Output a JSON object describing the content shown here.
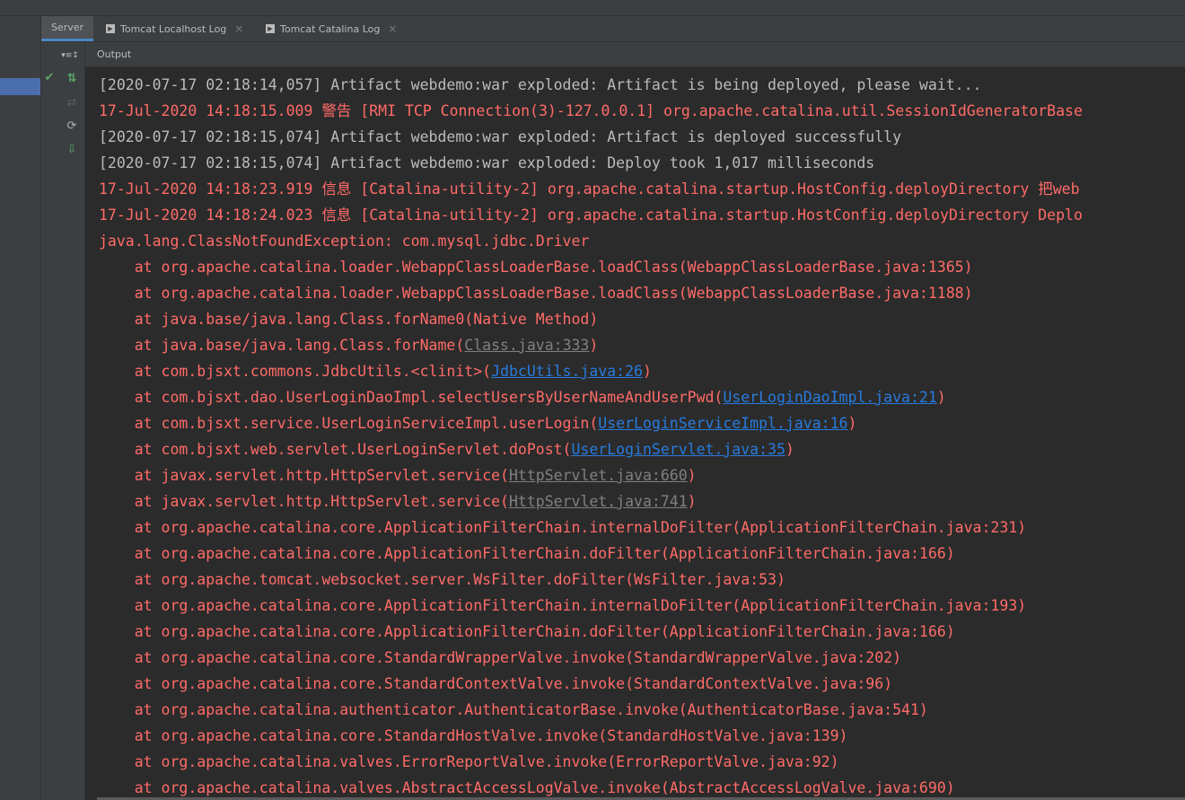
{
  "tabs": [
    {
      "label": "Server",
      "active": true,
      "closable": false
    },
    {
      "label": "Tomcat Localhost Log",
      "active": false,
      "closable": true
    },
    {
      "label": "Tomcat Catalina Log",
      "active": false,
      "closable": true
    }
  ],
  "tab_close_glyph": "×",
  "tab_run_glyph": "▶",
  "header": {
    "output_label": "Output"
  },
  "toolbar": {
    "options_glyph": "▾≡↕",
    "status_glyph": "✔",
    "update_glyph": "⇅",
    "redeploy_glyph": "⇄",
    "refresh_glyph": "⟳",
    "deploy_glyph": "⇩"
  },
  "colors": {
    "info": "#bbbbbb",
    "error": "#ff6b68",
    "link": "#287bde",
    "link_muted": "#808080",
    "accent": "#4b6eaf"
  },
  "log": {
    "lines": [
      {
        "type": "info",
        "text": "[2020-07-17 02:18:14,057] Artifact webdemo:war exploded: Artifact is being deployed, please wait..."
      },
      {
        "type": "err",
        "text": "17-Jul-2020 14:18:15.009 警告 [RMI TCP Connection(3)-127.0.0.1] org.apache.catalina.util.SessionIdGeneratorBase"
      },
      {
        "type": "info",
        "text": "[2020-07-17 02:18:15,074] Artifact webdemo:war exploded: Artifact is deployed successfully"
      },
      {
        "type": "info",
        "text": "[2020-07-17 02:18:15,074] Artifact webdemo:war exploded: Deploy took 1,017 milliseconds"
      },
      {
        "type": "err",
        "text": "17-Jul-2020 14:18:23.919 信息 [Catalina-utility-2] org.apache.catalina.startup.HostConfig.deployDirectory 把web"
      },
      {
        "type": "err",
        "text": "17-Jul-2020 14:18:24.023 信息 [Catalina-utility-2] org.apache.catalina.startup.HostConfig.deployDirectory Deplo"
      },
      {
        "type": "err",
        "text": "java.lang.ClassNotFoundException: com.mysql.jdbc.Driver"
      },
      {
        "type": "err",
        "text": "    at org.apache.catalina.loader.WebappClassLoaderBase.loadClass(WebappClassLoaderBase.java:1365)"
      },
      {
        "type": "err",
        "text": "    at org.apache.catalina.loader.WebappClassLoaderBase.loadClass(WebappClassLoaderBase.java:1188)"
      },
      {
        "type": "err",
        "text": "    at java.base/java.lang.Class.forName0(Native Method)"
      },
      {
        "type": "err",
        "text": "    at java.base/java.lang.Class.forName(",
        "link": "Class.java:333",
        "link_style": "grey",
        "after": ")"
      },
      {
        "type": "err",
        "text": "    at com.bjsxt.commons.JdbcUtils.<clinit>(",
        "link": "JdbcUtils.java:26",
        "link_style": "blue",
        "after": ")"
      },
      {
        "type": "err",
        "text": "    at com.bjsxt.dao.UserLoginDaoImpl.selectUsersByUserNameAndUserPwd(",
        "link": "UserLoginDaoImpl.java:21",
        "link_style": "blue",
        "after": ")"
      },
      {
        "type": "err",
        "text": "    at com.bjsxt.service.UserLoginServiceImpl.userLogin(",
        "link": "UserLoginServiceImpl.java:16",
        "link_style": "blue",
        "after": ")"
      },
      {
        "type": "err",
        "text": "    at com.bjsxt.web.servlet.UserLoginServlet.doPost(",
        "link": "UserLoginServlet.java:35",
        "link_style": "blue",
        "after": ")"
      },
      {
        "type": "err",
        "text": "    at javax.servlet.http.HttpServlet.service(",
        "link": "HttpServlet.java:660",
        "link_style": "grey",
        "after": ")"
      },
      {
        "type": "err",
        "text": "    at javax.servlet.http.HttpServlet.service(",
        "link": "HttpServlet.java:741",
        "link_style": "grey",
        "after": ")"
      },
      {
        "type": "err",
        "text": "    at org.apache.catalina.core.ApplicationFilterChain.internalDoFilter(ApplicationFilterChain.java:231)"
      },
      {
        "type": "err",
        "text": "    at org.apache.catalina.core.ApplicationFilterChain.doFilter(ApplicationFilterChain.java:166)"
      },
      {
        "type": "err",
        "text": "    at org.apache.tomcat.websocket.server.WsFilter.doFilter(WsFilter.java:53)"
      },
      {
        "type": "err",
        "text": "    at org.apache.catalina.core.ApplicationFilterChain.internalDoFilter(ApplicationFilterChain.java:193)"
      },
      {
        "type": "err",
        "text": "    at org.apache.catalina.core.ApplicationFilterChain.doFilter(ApplicationFilterChain.java:166)"
      },
      {
        "type": "err",
        "text": "    at org.apache.catalina.core.StandardWrapperValve.invoke(StandardWrapperValve.java:202)"
      },
      {
        "type": "err",
        "text": "    at org.apache.catalina.core.StandardContextValve.invoke(StandardContextValve.java:96)"
      },
      {
        "type": "err",
        "text": "    at org.apache.catalina.authenticator.AuthenticatorBase.invoke(AuthenticatorBase.java:541)"
      },
      {
        "type": "err",
        "text": "    at org.apache.catalina.core.StandardHostValve.invoke(StandardHostValve.java:139)"
      },
      {
        "type": "err",
        "text": "    at org.apache.catalina.valves.ErrorReportValve.invoke(ErrorReportValve.java:92)"
      },
      {
        "type": "err",
        "text": "    at org.apache.catalina.valves.AbstractAccessLogValve.invoke(AbstractAccessLogValve.java:690)"
      }
    ]
  }
}
